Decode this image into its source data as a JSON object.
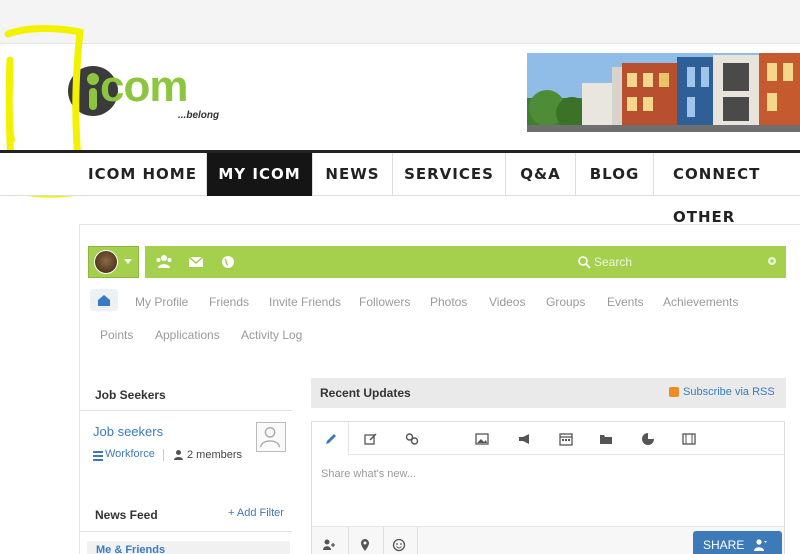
{
  "colors": {
    "accent_green": "#a4d04e",
    "logo_green": "#8cc63f",
    "nav_active_bg": "#151515",
    "link_blue": "#3a7bbf",
    "share_blue": "#3d7ab8",
    "highlight_yellow": "#f2f200"
  },
  "logo": {
    "wordmark": "com",
    "tagline": "...belong"
  },
  "mainnav": {
    "items": [
      {
        "label": "ICOM HOME",
        "active": false
      },
      {
        "label": "MY ICOM",
        "active": true
      },
      {
        "label": "NEWS",
        "active": false
      },
      {
        "label": "SERVICES",
        "active": false
      },
      {
        "label": "Q&A",
        "active": false
      },
      {
        "label": "BLOG",
        "active": false
      },
      {
        "label": "CONNECT OTHER",
        "active": false
      }
    ]
  },
  "toolbar": {
    "icons": [
      "group-icon",
      "mail-icon",
      "globe-icon"
    ],
    "search_label": "Search",
    "settings_icon": "gear-icon"
  },
  "subnav": {
    "row1": [
      "My Profile",
      "Friends",
      "Invite Friends",
      "Followers",
      "Photos",
      "Videos",
      "Groups",
      "Events",
      "Achievements"
    ],
    "row2": [
      "Points",
      "Applications",
      "Activity Log"
    ]
  },
  "sidebar": {
    "job_seekers_title": "Job Seekers",
    "group_name": "Job seekers",
    "group_category": "Workforce",
    "group_members": "2 members",
    "newsfeed_title": "News Feed",
    "add_filter": "+ Add Filter",
    "filter_item": "Me & Friends"
  },
  "updates": {
    "title": "Recent Updates",
    "rss_label": "Subscribe via RSS",
    "composer_placeholder": "Share what's new...",
    "composer_tools": [
      "pencil-icon",
      "edit-icon",
      "link-icon",
      "image-icon",
      "megaphone-icon",
      "calendar-icon",
      "folder-icon",
      "pie-chart-icon",
      "film-icon"
    ],
    "bottom_tools": [
      "tag-friend-icon",
      "location-icon",
      "smiley-icon"
    ],
    "share_label": "SHARE"
  }
}
